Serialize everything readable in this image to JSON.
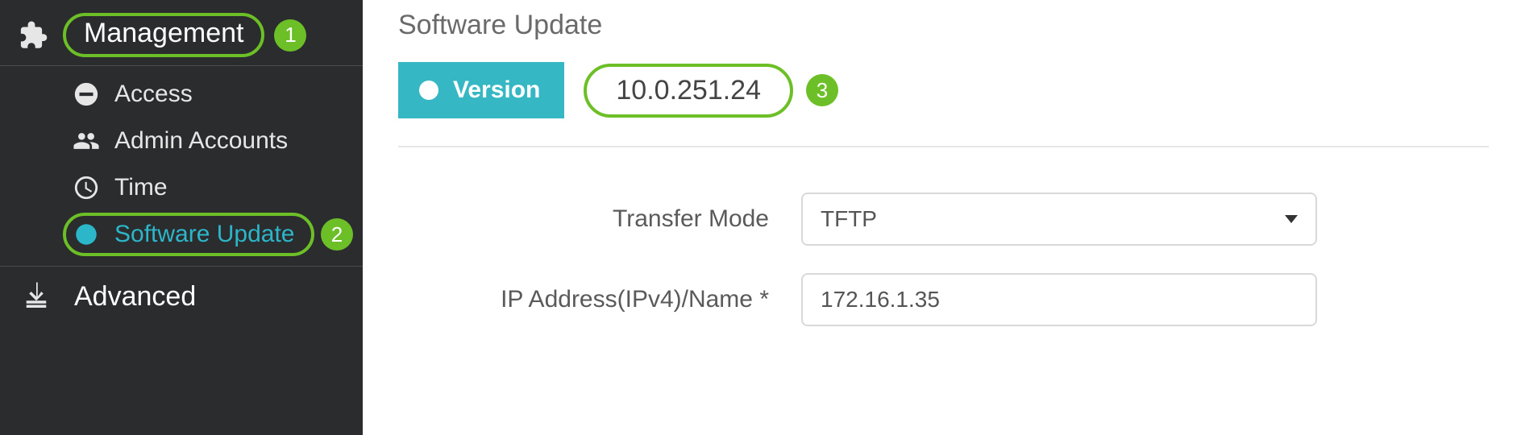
{
  "sidebar": {
    "management_label": "Management",
    "badge1": "1",
    "items": [
      {
        "label": "Access"
      },
      {
        "label": "Admin Accounts"
      },
      {
        "label": "Time"
      },
      {
        "label": "Software Update"
      }
    ],
    "badge2": "2",
    "advanced_label": "Advanced"
  },
  "main": {
    "title": "Software Update",
    "version_button": "Version",
    "version_value": "10.0.251.24",
    "badge3": "3",
    "form": {
      "transfer_mode_label": "Transfer Mode",
      "transfer_mode_value": "TFTP",
      "ip_label": "IP Address(IPv4)/Name *",
      "ip_value": "172.16.1.35"
    }
  }
}
